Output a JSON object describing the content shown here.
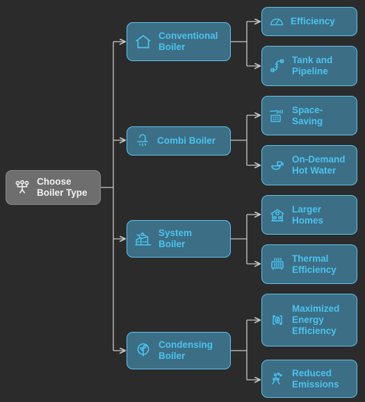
{
  "diagram": {
    "title": "Boiler Type Selection Mind Map",
    "background_color": "#2b2b2b",
    "edge_color": "#c9c9c9",
    "root_fill": "#6e6e6e",
    "root_border": "#8d8d8d",
    "root_text_color": "#f2f2f2",
    "node_fill": "#3c6e85",
    "node_border": "#5ec7ef",
    "node_text_color": "#4cc3f0"
  },
  "root": {
    "label": "Choose\nBoiler Type",
    "icon": "decision-tree-icon"
  },
  "branches": [
    {
      "label": "Conventional\nBoiler",
      "icon": "house-icon",
      "leaves": [
        {
          "label": "Efficiency",
          "icon": "gauge-icon"
        },
        {
          "label": "Tank and\nPipeline",
          "icon": "pipeline-icon"
        }
      ]
    },
    {
      "label": "Combi Boiler",
      "icon": "shower-icon",
      "leaves": [
        {
          "label": "Space-\nSaving",
          "icon": "compact-unit-icon"
        },
        {
          "label": "On-Demand\nHot Water",
          "icon": "hot-water-icon"
        }
      ]
    },
    {
      "label": "System\nBoiler",
      "icon": "factory-icon",
      "leaves": [
        {
          "label": "Larger\nHomes",
          "icon": "large-house-icon"
        },
        {
          "label": "Thermal\nEfficiency",
          "icon": "radiator-icon"
        }
      ]
    },
    {
      "label": "Condensing\nBoiler",
      "icon": "eco-leaf-icon",
      "leaves": [
        {
          "label": "Maximized\nEnergy\nEfficiency",
          "icon": "energy-recycle-icon"
        },
        {
          "label": "Reduced\nEmissions",
          "icon": "low-emission-icon"
        }
      ]
    }
  ]
}
